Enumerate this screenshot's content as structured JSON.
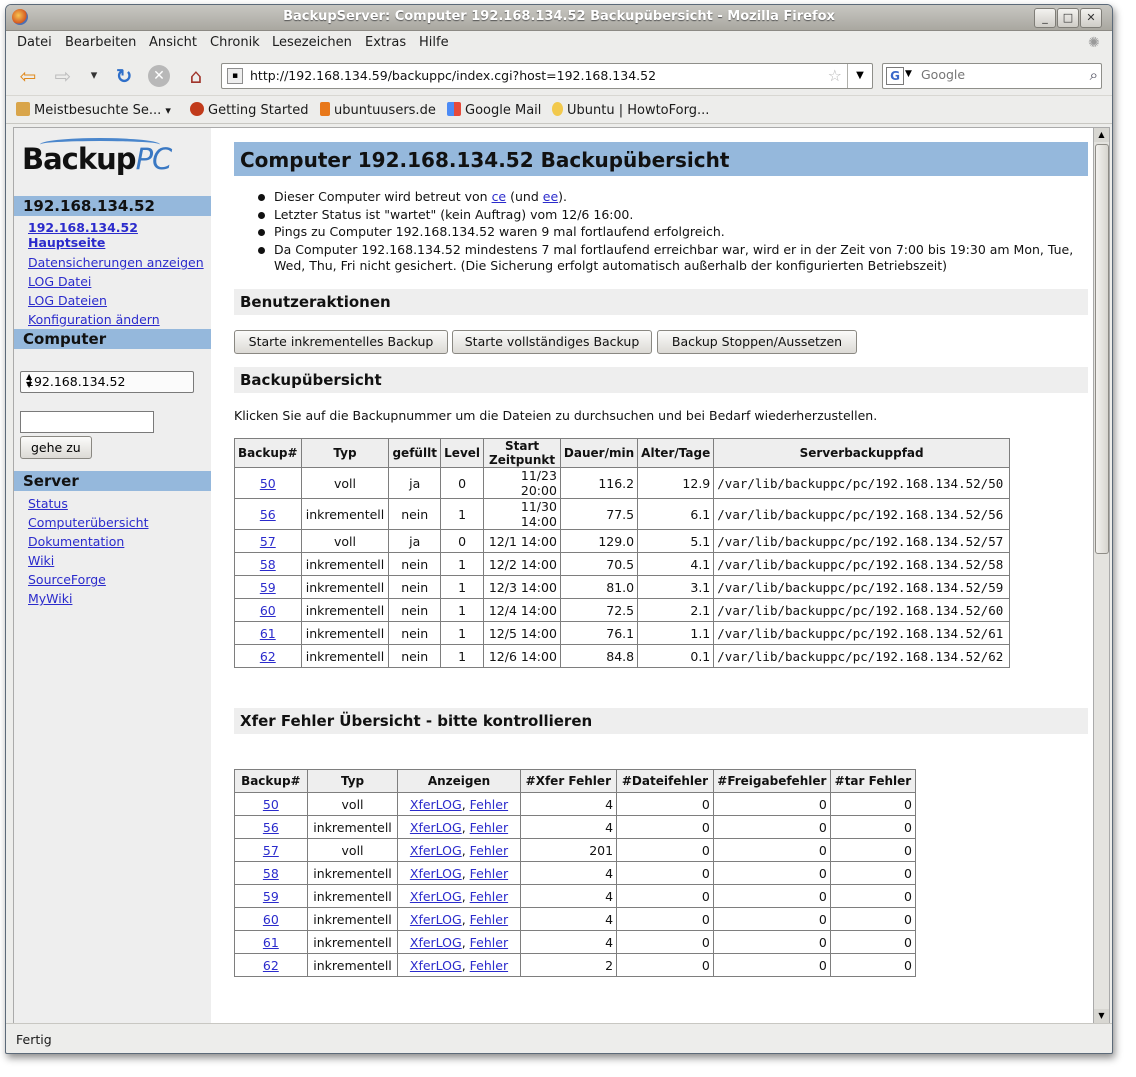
{
  "window": {
    "title": "BackupServer: Computer 192.168.134.52 Backupübersicht - Mozilla Firefox",
    "min": "_",
    "max": "□",
    "close": "✕"
  },
  "menu": [
    "Datei",
    "Bearbeiten",
    "Ansicht",
    "Chronik",
    "Lesezeichen",
    "Extras",
    "Hilfe"
  ],
  "nav": {
    "back": "⇦",
    "forward": "⇨",
    "history": "▾",
    "reload": "↻",
    "stop": "✕",
    "home": "⌂",
    "url": "http://192.168.134.59/backuppc/index.cgi?host=192.168.134.52",
    "search_placeholder": "Google",
    "search_engine": "G"
  },
  "bookmarks": [
    {
      "label": "Meistbesuchte Se...",
      "icon": "folder-icon",
      "color": "#d9a54a",
      "arrow": "▾"
    },
    {
      "label": "Getting Started",
      "icon": "firefox-icon",
      "color": "#c13b1b"
    },
    {
      "label": "ubuntuusers.de",
      "icon": "ubuntuusers-icon",
      "color": "#e8781a"
    },
    {
      "label": "Google Mail",
      "icon": "google-icon",
      "color": "#4c8bf5"
    },
    {
      "label": "Ubuntu | HowtoForg...",
      "icon": "bulb-icon",
      "color": "#f2c94c"
    }
  ],
  "status": "Fertig",
  "sidebar": {
    "logo_main": "Backup",
    "logo_suffix": "PC",
    "host_header": "192.168.134.52",
    "host_links": [
      "192.168.134.52 Hauptseite",
      "Datensicherungen anzeigen",
      "LOG Datei",
      "LOG Dateien",
      "Konfiguration ändern"
    ],
    "computer_header": "Computer",
    "host_select": "192.168.134.52",
    "goto_label": "gehe zu",
    "server_header": "Server",
    "server_links": [
      "Status",
      "Computerübersicht",
      "Dokumentation",
      "Wiki",
      "SourceForge",
      "MyWiki"
    ]
  },
  "main": {
    "title": "Computer 192.168.134.52 Backupübersicht",
    "b1_pre": "Dieser Computer wird betreut von ",
    "b1_user1": "ce",
    "b1_mid": " (und ",
    "b1_user2": "ee",
    "b1_post": ").",
    "b2": "Letzter Status ist \"wartet\" (kein Auftrag) vom 12/6 16:00.",
    "b3": "Pings zu Computer 192.168.134.52 waren 9 mal fortlaufend erfolgreich.",
    "b4": "Da Computer 192.168.134.52 mindestens 7 mal fortlaufend erreichbar war, wird er in der Zeit von 7:00 bis 19:30 am Mon, Tue, Wed, Thu, Fri nicht gesichert. (Die Sicherung erfolgt automatisch außerhalb der konfigurierten Betriebszeit)",
    "actions_header": "Benutzeraktionen",
    "btn_incr": "Starte inkrementelles Backup",
    "btn_full": "Starte vollständiges Backup",
    "btn_stop": "Backup Stoppen/Aussetzen",
    "summary_header": "Backupübersicht",
    "summary_desc": "Klicken Sie auf die Backupnummer um die Dateien zu durchsuchen und bei Bedarf wiederherzustellen.",
    "xfer_header": "Xfer Fehler Übersicht - bitte kontrollieren"
  },
  "backup_table": {
    "headers": [
      "Backup#",
      "Typ",
      "gefüllt",
      "Level",
      "Start Zeitpunkt",
      "Dauer/min",
      "Alter/Tage",
      "Serverbackuppfad"
    ],
    "rows": [
      [
        "50",
        "voll",
        "ja",
        "0",
        "11/23 20:00",
        "116.2",
        "12.9",
        "/var/lib/backuppc/pc/192.168.134.52/50"
      ],
      [
        "56",
        "inkrementell",
        "nein",
        "1",
        "11/30 14:00",
        "77.5",
        "6.1",
        "/var/lib/backuppc/pc/192.168.134.52/56"
      ],
      [
        "57",
        "voll",
        "ja",
        "0",
        "12/1 14:00",
        "129.0",
        "5.1",
        "/var/lib/backuppc/pc/192.168.134.52/57"
      ],
      [
        "58",
        "inkrementell",
        "nein",
        "1",
        "12/2 14:00",
        "70.5",
        "4.1",
        "/var/lib/backuppc/pc/192.168.134.52/58"
      ],
      [
        "59",
        "inkrementell",
        "nein",
        "1",
        "12/3 14:00",
        "81.0",
        "3.1",
        "/var/lib/backuppc/pc/192.168.134.52/59"
      ],
      [
        "60",
        "inkrementell",
        "nein",
        "1",
        "12/4 14:00",
        "72.5",
        "2.1",
        "/var/lib/backuppc/pc/192.168.134.52/60"
      ],
      [
        "61",
        "inkrementell",
        "nein",
        "1",
        "12/5 14:00",
        "76.1",
        "1.1",
        "/var/lib/backuppc/pc/192.168.134.52/61"
      ],
      [
        "62",
        "inkrementell",
        "nein",
        "1",
        "12/6 14:00",
        "84.8",
        "0.1",
        "/var/lib/backuppc/pc/192.168.134.52/62"
      ]
    ]
  },
  "xfer_table": {
    "headers": [
      "Backup#",
      "Typ",
      "Anzeigen",
      "#Xfer Fehler",
      "#Dateifehler",
      "#Freigabefehler",
      "#tar Fehler"
    ],
    "link_xferlog": "XferLOG",
    "link_sep": ", ",
    "link_errors": "Fehler",
    "rows": [
      [
        "50",
        "voll",
        "4",
        "0",
        "0",
        "0"
      ],
      [
        "56",
        "inkrementell",
        "4",
        "0",
        "0",
        "0"
      ],
      [
        "57",
        "voll",
        "201",
        "0",
        "0",
        "0"
      ],
      [
        "58",
        "inkrementell",
        "4",
        "0",
        "0",
        "0"
      ],
      [
        "59",
        "inkrementell",
        "4",
        "0",
        "0",
        "0"
      ],
      [
        "60",
        "inkrementell",
        "4",
        "0",
        "0",
        "0"
      ],
      [
        "61",
        "inkrementell",
        "4",
        "0",
        "0",
        "0"
      ],
      [
        "62",
        "inkrementell",
        "2",
        "0",
        "0",
        "0"
      ]
    ]
  }
}
